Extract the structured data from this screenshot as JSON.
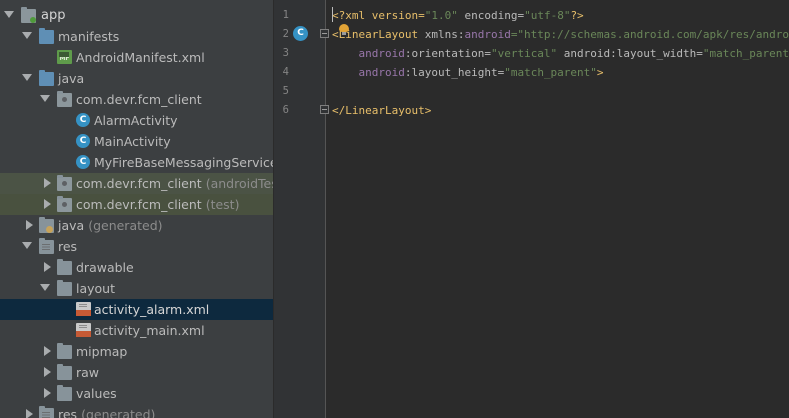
{
  "tree": {
    "items": [
      {
        "label": "app",
        "sub": ""
      },
      {
        "label": "manifests",
        "sub": ""
      },
      {
        "label": "AndroidManifest.xml",
        "sub": ""
      },
      {
        "label": "java",
        "sub": ""
      },
      {
        "label": "com.devr.fcm_client",
        "sub": ""
      },
      {
        "label": "AlarmActivity",
        "sub": ""
      },
      {
        "label": "MainActivity",
        "sub": ""
      },
      {
        "label": "MyFireBaseMessagingService",
        "sub": ""
      },
      {
        "label": "com.devr.fcm_client",
        "sub": "(androidTest)"
      },
      {
        "label": "com.devr.fcm_client",
        "sub": "(test)"
      },
      {
        "label": "java",
        "sub": "(generated)"
      },
      {
        "label": "res",
        "sub": ""
      },
      {
        "label": "drawable",
        "sub": ""
      },
      {
        "label": "layout",
        "sub": ""
      },
      {
        "label": "activity_alarm.xml",
        "sub": ""
      },
      {
        "label": "activity_main.xml",
        "sub": ""
      },
      {
        "label": "mipmap",
        "sub": ""
      },
      {
        "label": "raw",
        "sub": ""
      },
      {
        "label": "values",
        "sub": ""
      },
      {
        "label": "res",
        "sub": "(generated)"
      }
    ],
    "class_icon_letter": "C",
    "manifest_icon_text": "MF"
  },
  "editor": {
    "line_numbers": [
      "1",
      "2",
      "3",
      "4",
      "5",
      "6"
    ],
    "gutter_class_letter": "C",
    "lines": [
      {
        "a": "<?xml version=",
        "b": "\"1.0\"",
        "c": " encoding=",
        "d": "\"utf-8\"",
        "e": "?>"
      },
      {
        "a": "<LinearLayout",
        "b": " xmlns:",
        "c": "android",
        "d": "=\"http://schemas.android.com/apk/res/android\"",
        "e": ""
      },
      {
        "a": "    android",
        "b": ":orientation=",
        "c": "\"vertical\"",
        "d": " android:layout_width=",
        "e": "\"match_parent\""
      },
      {
        "a": "    android",
        "b": ":layout_height=",
        "c": "\"match_parent\"",
        "d": ">",
        "e": ""
      },
      {
        "a": "",
        "b": "",
        "c": "",
        "d": "",
        "e": ""
      },
      {
        "a": "</LinearLayout>",
        "b": "",
        "c": "",
        "d": "",
        "e": ""
      }
    ]
  },
  "colors": {
    "tree_bg": "#3c3f41",
    "editor_bg": "#2b2b2b",
    "selection": "#0d293e",
    "test_highlight": "#4b5345",
    "xml_tag": "#e8bf6a",
    "xml_value": "#6a8759",
    "namespace": "#9876aa"
  }
}
